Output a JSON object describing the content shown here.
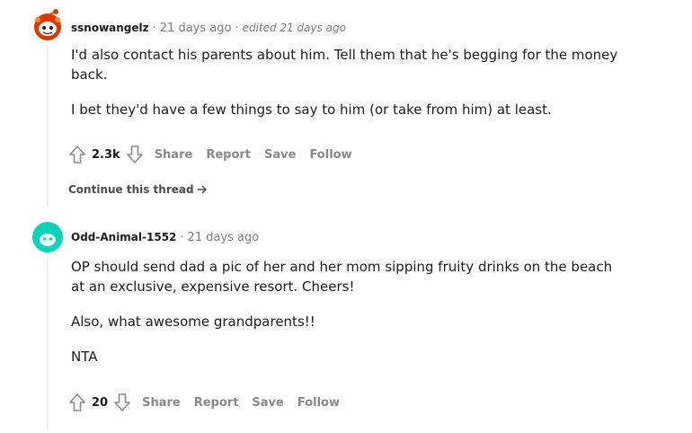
{
  "comments": [
    {
      "author": "ssnowangelz",
      "time": "21 days ago",
      "edited": "edited 21 days ago",
      "avatar_icon": "snoo-red-avatar-icon",
      "paragraphs": [
        "I'd also contact his parents about him. Tell them that he's begging for the money back.",
        "I bet they'd have a few things to say to him (or take from him) at least."
      ],
      "votes": "2.3k",
      "actions": {
        "share": "Share",
        "report": "Report",
        "save": "Save",
        "follow": "Follow"
      },
      "continue_label": "Continue this thread"
    },
    {
      "author": "Odd-Animal-1552",
      "time": "21 days ago",
      "avatar_icon": "teal-default-avatar-icon",
      "paragraphs": [
        "OP should send dad a pic of her and her mom sipping fruity drinks on the beach at an exclusive, expensive resort. Cheers!",
        "Also, what awesome grandparents!!",
        "NTA"
      ],
      "votes": "20",
      "actions": {
        "share": "Share",
        "report": "Report",
        "save": "Save",
        "follow": "Follow"
      }
    }
  ],
  "colors": {
    "meta": "#7c7c7c",
    "action": "#878a8c",
    "text": "#1c1c1c",
    "avatar_red": "#d93a00",
    "avatar_teal": "#0dd3bb"
  },
  "separator": "·"
}
